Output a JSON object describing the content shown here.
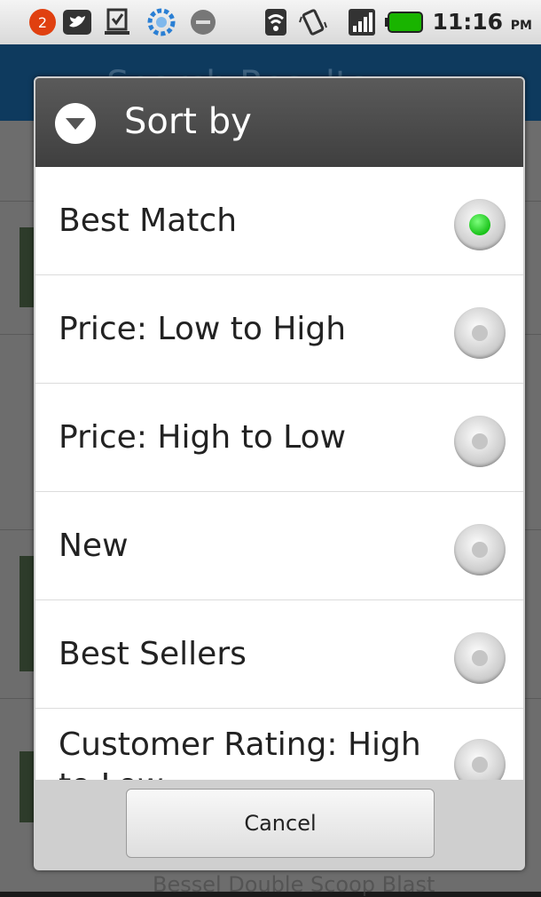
{
  "status_bar": {
    "notification_count": "2",
    "time": "11:16",
    "ampm": "PM",
    "icons": [
      "notification-count-icon",
      "twitter-icon",
      "download-icon",
      "sync-icon",
      "voicemail-icon",
      "wifi-icon",
      "vibrate-icon",
      "signal-icon",
      "battery-icon"
    ],
    "colors": {
      "notification_badge": "#e04010",
      "battery": "#19b400"
    }
  },
  "background_app": {
    "title": "Search Results",
    "footer_text": "Bessel Double Scoop Blast"
  },
  "dialog": {
    "title": "Sort by",
    "icon": "chevron-down-circle-icon",
    "options": [
      {
        "label": "Best Match",
        "selected": true
      },
      {
        "label": "Price: Low to High",
        "selected": false
      },
      {
        "label": "Price: High to Low",
        "selected": false
      },
      {
        "label": "New",
        "selected": false
      },
      {
        "label": "Best Sellers",
        "selected": false
      },
      {
        "label": "Customer Rating: High to Low",
        "selected": false
      }
    ],
    "cancel_label": "Cancel",
    "colors": {
      "selected_radio": "#19c219",
      "header": "#4a4a4a"
    }
  }
}
